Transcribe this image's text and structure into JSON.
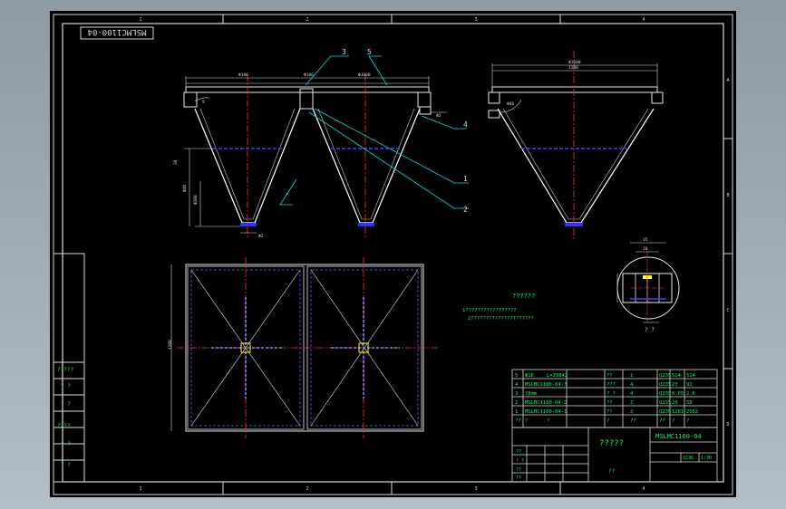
{
  "drawing": {
    "code_stamp": "MSLMC1100-04",
    "leader_labels": [
      "3",
      "5",
      "4",
      "1",
      "2"
    ],
    "dimensions": [
      "Ф186",
      "Ф1600",
      "Ф186",
      "Ф2",
      "9",
      "Ф2",
      "38",
      "Ф40",
      "Ф300",
      "Ф1600",
      "1200",
      "Ф40"
    ],
    "technical_requirements": {
      "title": "??????",
      "line1": "1?????????????????",
      "line2": "2?????????????????????"
    },
    "detail_label": "? ?"
  },
  "side_table": [
    "?????",
    "?  ?",
    "?  ?",
    "????",
    "?  ?",
    "?  ?"
  ],
  "grid": {
    "top": [
      "1",
      "2",
      "3",
      "4"
    ],
    "bottom": [
      "1",
      "2",
      "3",
      "4"
    ],
    "right": [
      "A",
      "B",
      "C",
      "D"
    ]
  },
  "bom": {
    "rows": [
      [
        "5",
        "Ф16",
        "L=29842",
        "??",
        "1",
        "Q235",
        "514",
        "514"
      ],
      [
        "4",
        "MSLMC1100-04-3",
        "",
        "???",
        "4",
        "Q235",
        "23",
        "92"
      ],
      [
        "3",
        "?8mm",
        "",
        "?  ?",
        "4",
        "Q235",
        "0.65",
        "2.6"
      ],
      [
        "2",
        "MSLMC1100-04-2",
        "",
        "??",
        "2",
        "Q235",
        "29",
        "58"
      ],
      [
        "1",
        "MSLMC1100-04-1",
        "",
        "??",
        "2",
        "Q235",
        "1281",
        "2562"
      ]
    ],
    "header": [
      "??",
      "?",
      "?",
      "?",
      "??",
      "??",
      "?",
      "?"
    ]
  },
  "title_block": {
    "drawing_no": "MSLMC1100-04",
    "name": "?????",
    "org": "??",
    "weight": "3236",
    "scale": "1:30",
    "small_a": "??",
    "small_b": "?  ?",
    "small_c": "??",
    "small_d": "??"
  }
}
